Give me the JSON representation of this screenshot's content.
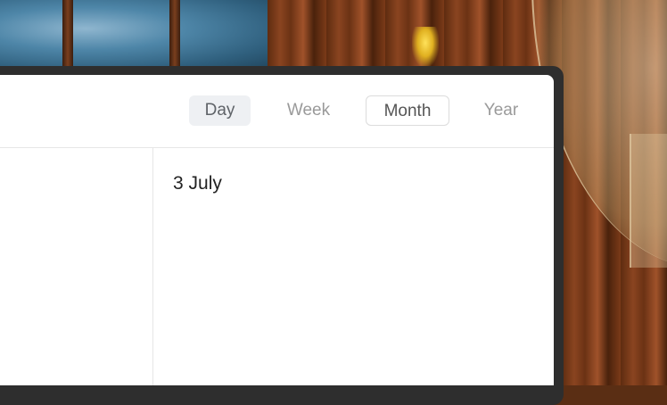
{
  "toolbar": {
    "tabs": [
      {
        "label": "Day",
        "state": "active"
      },
      {
        "label": "Week",
        "state": "inactive"
      },
      {
        "label": "Month",
        "state": "outlined"
      },
      {
        "label": "Year",
        "state": "inactive"
      }
    ]
  },
  "main": {
    "date_heading": "3 July"
  },
  "colors": {
    "surface": "#ffffff",
    "window_frame": "#2e2e2e",
    "tab_active_bg": "#eef0f3",
    "tab_inactive_text": "#9a9a9a",
    "divider": "#e6e6e6"
  }
}
